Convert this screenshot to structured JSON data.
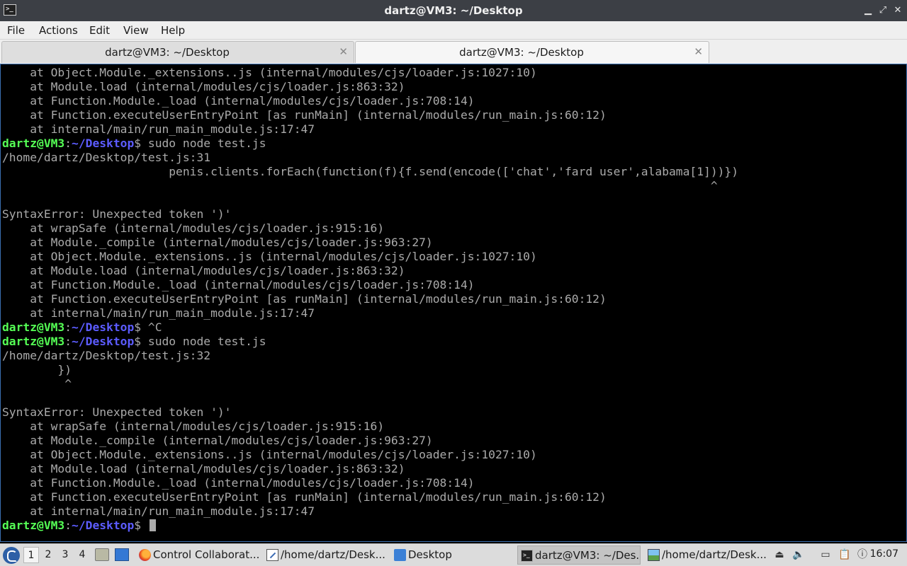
{
  "window": {
    "title": "dartz@VM3: ~/Desktop",
    "app_icon": "terminal-icon",
    "controls": {
      "minimize": "▁",
      "maximize": "⤢",
      "close": "✕"
    }
  },
  "menubar": {
    "items": [
      "File",
      "Actions",
      "Edit",
      "View",
      "Help"
    ]
  },
  "tabs": [
    {
      "label": "dartz@VM3: ~/Desktop",
      "close": "✕",
      "active": false
    },
    {
      "label": "dartz@VM3: ~/Desktop",
      "close": "✕",
      "active": true
    }
  ],
  "terminal": {
    "prompt_user": "dartz@VM3",
    "prompt_sep": ":",
    "prompt_path": "~/Desktop",
    "prompt_end": "$ ",
    "lines": [
      {
        "text": "    at Object.Module._extensions..js (internal/modules/cjs/loader.js:1027:10)"
      },
      {
        "text": "    at Module.load (internal/modules/cjs/loader.js:863:32)"
      },
      {
        "text": "    at Function.Module._load (internal/modules/cjs/loader.js:708:14)"
      },
      {
        "text": "    at Function.executeUserEntryPoint [as runMain] (internal/modules/run_main.js:60:12)"
      },
      {
        "text": "    at internal/main/run_main_module.js:17:47"
      },
      {
        "prompt": true,
        "text": "sudo node test.js"
      },
      {
        "text": "/home/dartz/Desktop/test.js:31"
      },
      {
        "text": "                        penis.clients.forEach(function(f){f.send(encode(['chat','fard user',alabama[1]))})"
      },
      {
        "text": "                                                                                                      ^"
      },
      {
        "text": ""
      },
      {
        "text": "SyntaxError: Unexpected token ')'"
      },
      {
        "text": "    at wrapSafe (internal/modules/cjs/loader.js:915:16)"
      },
      {
        "text": "    at Module._compile (internal/modules/cjs/loader.js:963:27)"
      },
      {
        "text": "    at Object.Module._extensions..js (internal/modules/cjs/loader.js:1027:10)"
      },
      {
        "text": "    at Module.load (internal/modules/cjs/loader.js:863:32)"
      },
      {
        "text": "    at Function.Module._load (internal/modules/cjs/loader.js:708:14)"
      },
      {
        "text": "    at Function.executeUserEntryPoint [as runMain] (internal/modules/run_main.js:60:12)"
      },
      {
        "text": "    at internal/main/run_main_module.js:17:47"
      },
      {
        "prompt": true,
        "text": "^C"
      },
      {
        "prompt": true,
        "text": "sudo node test.js"
      },
      {
        "text": "/home/dartz/Desktop/test.js:32"
      },
      {
        "text": "        })"
      },
      {
        "text": "         ^"
      },
      {
        "text": ""
      },
      {
        "text": "SyntaxError: Unexpected token ')'"
      },
      {
        "text": "    at wrapSafe (internal/modules/cjs/loader.js:915:16)"
      },
      {
        "text": "    at Module._compile (internal/modules/cjs/loader.js:963:27)"
      },
      {
        "text": "    at Object.Module._extensions..js (internal/modules/cjs/loader.js:1027:10)"
      },
      {
        "text": "    at Module.load (internal/modules/cjs/loader.js:863:32)"
      },
      {
        "text": "    at Function.Module._load (internal/modules/cjs/loader.js:708:14)"
      },
      {
        "text": "    at Function.executeUserEntryPoint [as runMain] (internal/modules/run_main.js:60:12)"
      },
      {
        "text": "    at internal/main/run_main_module.js:17:47"
      },
      {
        "prompt": true,
        "text": "",
        "cursor": true
      }
    ]
  },
  "taskbar": {
    "start_icon": "start-menu-icon",
    "workspaces": [
      "1",
      "2",
      "3",
      "4"
    ],
    "active_workspace": "1",
    "quick_launch": [
      "file-manager-icon",
      "show-desktop-icon"
    ],
    "tasks": [
      {
        "label": "Control Collaborat...",
        "icon": "firefox-icon"
      },
      {
        "label": "/home/dartz/Desk...",
        "icon": "text-editor-icon"
      },
      {
        "label": "Desktop",
        "icon": "folder-icon"
      },
      {
        "label": "dartz@VM3: ~/Des...",
        "icon": "terminal-icon",
        "active": true
      },
      {
        "label": "/home/dartz/Desk...",
        "icon": "image-viewer-icon"
      }
    ],
    "tray": [
      "eject-icon",
      "volume-icon",
      "network-icon",
      "clipboard-icon",
      "update-notifier-icon"
    ],
    "clock": "16:07"
  },
  "colors": {
    "prompt_user": "#55ff55",
    "prompt_path": "#5c5cff",
    "terminal_text": "#aaaaaa",
    "terminal_bg": "#000000"
  }
}
